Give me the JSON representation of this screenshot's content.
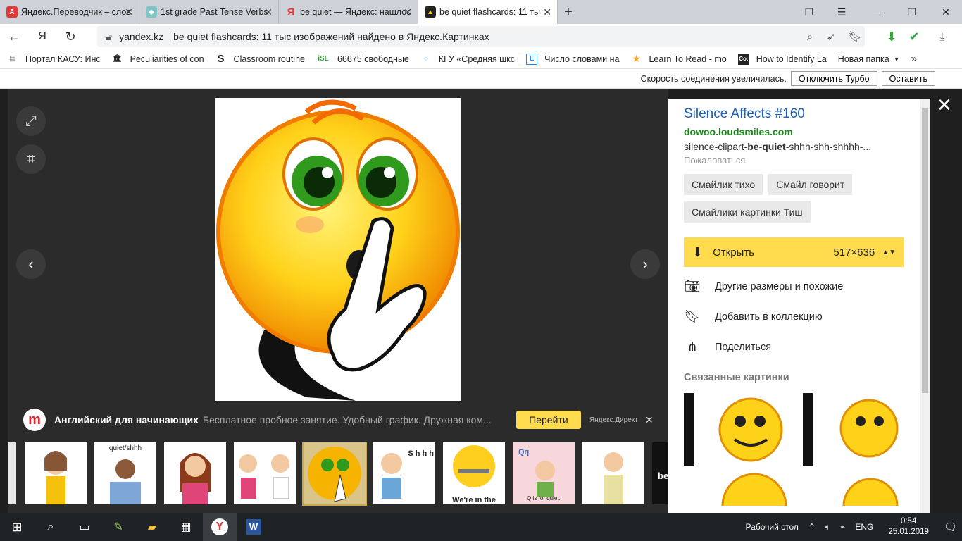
{
  "tabs": [
    {
      "label": "Яндекс.Переводчик – слов",
      "icon": "yandex-translate-icon",
      "active": false
    },
    {
      "label": "1st grade Past Tense Verbs",
      "icon": "eraser-icon",
      "active": false
    },
    {
      "label": "be quiet — Яндекс: нашлос",
      "icon": "yandex-y-icon",
      "active": false
    },
    {
      "label": "be quiet flashcards: 11 ты",
      "icon": "images-icon",
      "active": true
    }
  ],
  "address": {
    "domain": "yandex.kz",
    "title": "be quiet flashcards: 11 тыс изображений найдено в Яндекс.Картинках"
  },
  "bookmarks": [
    "Портал КАСУ: Инс",
    "Peculiarities of con",
    "Classroom routine",
    "66675 свободные",
    "КГУ «Средняя шкс",
    "Число словами на",
    "Learn To Read - mo",
    "How to Identify La",
    "Новая папка"
  ],
  "bookmark_icon_text": {
    "isl": "iSL",
    "e": "E",
    "s": "S",
    "co": "Co."
  },
  "infobar": {
    "message": "Скорость соединения увеличилась.",
    "disable_turbo": "Отключить Турбо",
    "keep": "Оставить"
  },
  "ad": {
    "logo": "m",
    "title": "Английский для начинающих",
    "desc": "Бесплатное пробное занятие. Удобный график. Дружная ком...",
    "go": "Перейти",
    "direct": "Яндекс.Директ",
    "close": "✕"
  },
  "thumb_texts": {
    "quiet": "quiet/shhh",
    "shhh": "S h h h",
    "were": "We're in the",
    "qq": "Qq",
    "qfor": "Q is for quiet.",
    "be": "be"
  },
  "panel": {
    "title": "Silence Affects #160",
    "site": "dowoo.loudsmiles.com",
    "desc_pre": "silence-clipart-",
    "desc_bold": "be-quiet",
    "desc_post": "-shhh-shh-shhhh-...",
    "complain": "Пожаловаться",
    "tags": [
      "Смайлик тихо",
      "Смайл говорит",
      "Смайлики картинки Тиш"
    ],
    "open": "Открыть",
    "size": "517×636",
    "actions": [
      "Другие размеры и похожие",
      "Добавить в коллекцию",
      "Поделиться"
    ],
    "related": "Связанные картинки"
  },
  "taskbar": {
    "desktop": "Рабочий стол",
    "lang": "ENG",
    "time": "0:54",
    "date": "25.01.2019",
    "word": "W"
  },
  "colors": {
    "accent_yellow": "#ffdb4d",
    "link_blue": "#1a5fbd",
    "site_green": "#1a8a1a"
  }
}
